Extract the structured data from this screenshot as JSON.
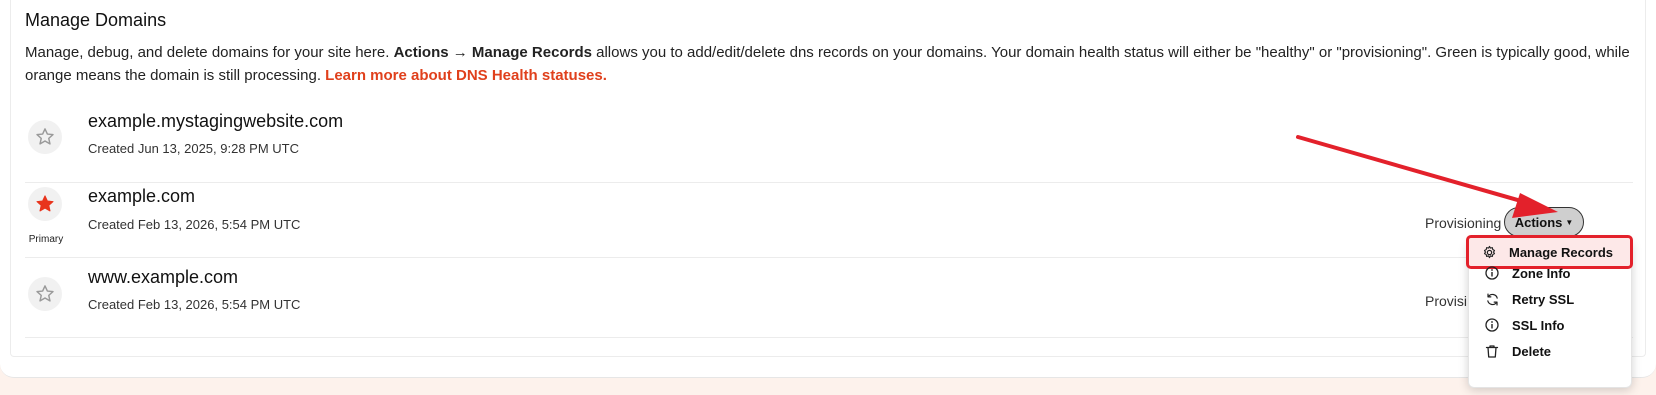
{
  "section": {
    "title": "Manage Domains",
    "desc_intro": "Manage, debug, and delete domains for your site here. ",
    "desc_bold": "Actions → Manage Records",
    "desc_middle": " allows you to add/edit/delete dns records on your domains. Your domain health status will either be \"healthy\" or \"provisioning\". Green is typically good, while orange means the domain is still processing. ",
    "desc_link": "Learn more about DNS Health statuses."
  },
  "domains": [
    {
      "name": "example.mystagingwebsite.com",
      "created": "Created Jun 13, 2025, 9:28 PM UTC",
      "primary": false
    },
    {
      "name": "example.com",
      "created": "Created Feb 13, 2026, 5:54 PM UTC",
      "primary": true,
      "primary_label": "Primary",
      "status": "Provisioning"
    },
    {
      "name": "www.example.com",
      "created": "Created Feb 13, 2026, 5:54 PM UTC",
      "primary": false,
      "status": "Provisi"
    }
  ],
  "actions": {
    "label": "Actions",
    "menu": [
      {
        "label": "Manage Records",
        "icon": "gear-icon"
      },
      {
        "label": "Zone Info",
        "icon": "info-icon"
      },
      {
        "label": "Retry SSL",
        "icon": "refresh-icon"
      },
      {
        "label": "SSL Info",
        "icon": "info-icon"
      },
      {
        "label": "Delete",
        "icon": "trash-icon"
      }
    ]
  },
  "colors": {
    "accent": "#e0401c",
    "primary_star": "#e8341c",
    "provisioning": "#f0a020",
    "annotation": "#e3212b"
  }
}
